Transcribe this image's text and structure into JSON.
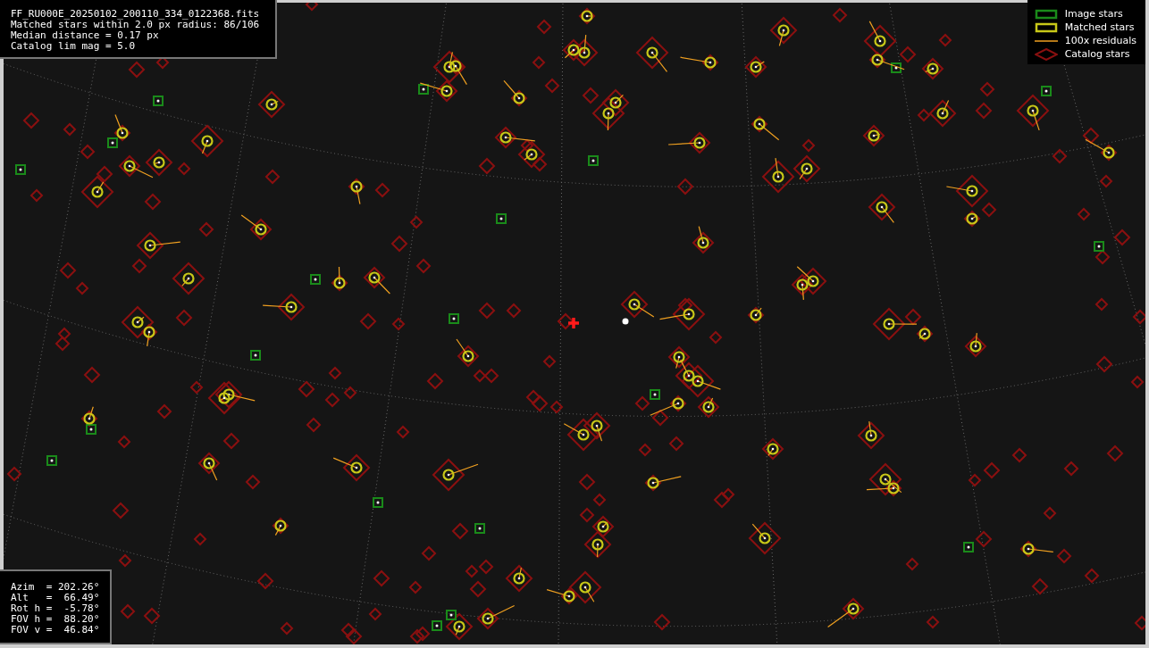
{
  "plot_info": {
    "lines": [
      "FF_RU000E_20250102_200110_334_0122368.fits",
      "Matched stars within 2.0 px radius: 86/106",
      "Median distance = 0.17 px",
      "Catalog lim mag = 5.0"
    ]
  },
  "legend": [
    {
      "kind": "image",
      "label": "Image stars"
    },
    {
      "kind": "matched",
      "label": "Matched stars"
    },
    {
      "kind": "residual",
      "label": "100x residuals"
    },
    {
      "kind": "catalog",
      "label": "Catalog stars"
    }
  ],
  "pointing": {
    "lines": [
      "Azim  = 202.26°",
      "Alt   =  66.49°",
      "Rot h =  -5.78°",
      "FOV h =  88.20°",
      "FOV v =  46.84°"
    ]
  }
}
